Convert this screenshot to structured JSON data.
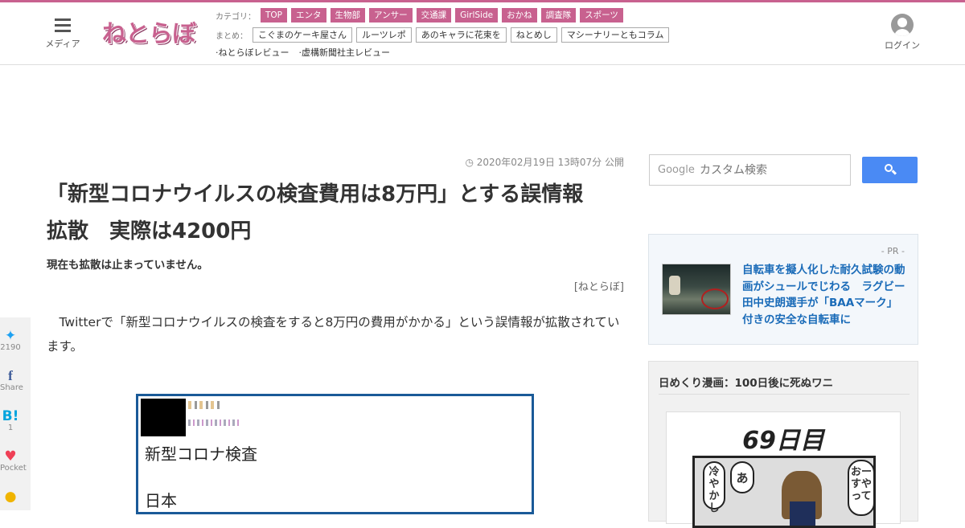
{
  "header": {
    "menu_label": "メディア",
    "logo_text": "ねとらぼ",
    "category_label": "カテゴリ：",
    "categories": [
      "TOP",
      "エンタ",
      "生物部",
      "アンサー",
      "交通課",
      "GirlSide",
      "おかね",
      "調査隊",
      "スポーツ"
    ],
    "matome_label": "まとめ：",
    "matome": [
      "こぐまのケーキ屋さん",
      "ルーツレポ",
      "あのキャラに花束を",
      "ねとめし",
      "マシーナリーともコラム"
    ],
    "reviews": [
      "·ねとらぼレビュー",
      "·虚構新聞社主レビュー"
    ],
    "login_label": "ログイン"
  },
  "article": {
    "date": "◷ 2020年02月19日 13時07分 公開",
    "title_line1": "「新型コロナウイルスの検査費用は8万円」とする誤情報",
    "title_line2": "拡散　実際は4200円",
    "subtitle": "現在も拡散は止まっていません。",
    "source": "[ねとらぼ]",
    "body": "Twitterで「新型コロナウイルスの検査をすると8万円の費用がかかる」という誤情報が拡散されています。",
    "tweet_line1": "新型コロナ検査",
    "tweet_line2": "日本"
  },
  "share": {
    "twitter_count": "2190",
    "facebook_label": "Share",
    "hatena_icon": "B!",
    "hatena_count": "1",
    "pocket_label": "Pocket"
  },
  "sidebar": {
    "search_brand": "Google",
    "search_placeholder": "カスタム検索",
    "pr_label": "- PR -",
    "pr_text": "自転車を擬人化した耐久試験の動画がシュールでじわる　ラグビー田中史朗選手が「BAAマーク」付きの安全な自転車に",
    "manga_heading": "日めくり漫画：100日後に死ぬワニ",
    "manga_day": "69日目",
    "manga_bubble1": "冷やかし",
    "manga_bubble2": "あ",
    "manga_bubble3": "おーすやって"
  },
  "colors": {
    "brand": "#c8618f",
    "link": "#1a6bb8",
    "search_button": "#4a8af4"
  }
}
